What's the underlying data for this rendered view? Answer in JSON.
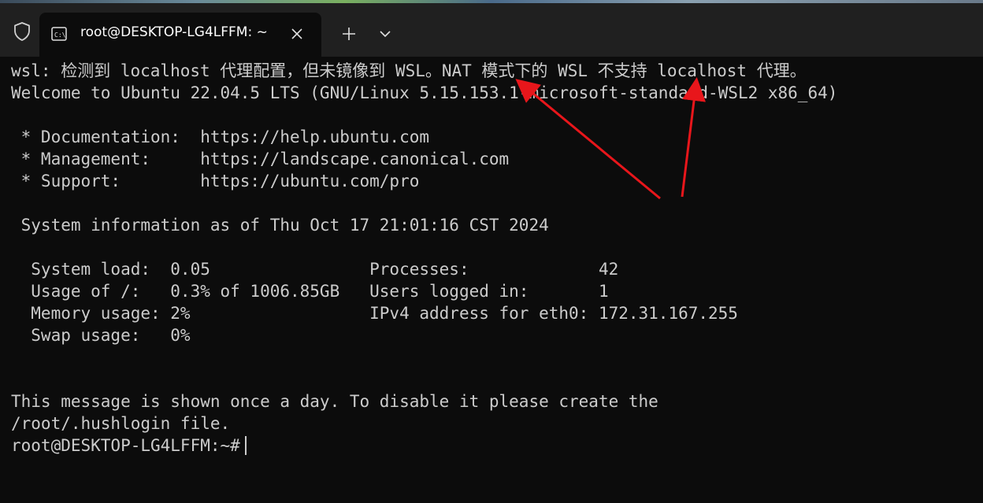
{
  "window": {
    "tab_title": "root@DESKTOP-LG4LFFM: ~",
    "tab_icon": "terminal-icon",
    "shield_icon": "shield-icon",
    "close_icon": "close-icon",
    "new_tab_icon": "plus-icon",
    "dropdown_icon": "chevron-down-icon"
  },
  "terminal": {
    "lines": [
      "wsl: 检测到 localhost 代理配置，但未镜像到 WSL。NAT 模式下的 WSL 不支持 localhost 代理。",
      "Welcome to Ubuntu 22.04.5 LTS (GNU/Linux 5.15.153.1-microsoft-standard-WSL2 x86_64)",
      "",
      " * Documentation:  https://help.ubuntu.com",
      " * Management:     https://landscape.canonical.com",
      " * Support:        https://ubuntu.com/pro",
      "",
      " System information as of Thu Oct 17 21:01:16 CST 2024",
      "",
      "  System load:  0.05                Processes:             42",
      "  Usage of /:   0.3% of 1006.85GB   Users logged in:       1",
      "  Memory usage: 2%                  IPv4 address for eth0: 172.31.167.255",
      "  Swap usage:   0%",
      "",
      "",
      "This message is shown once a day. To disable it please create the",
      "/root/.hushlogin file.",
      "root@DESKTOP-LG4LFFM:~#"
    ]
  },
  "colors": {
    "background": "#0c0c0c",
    "text": "#cccccc",
    "titlebar": "#202020",
    "annotation_arrow": "#e8161b"
  }
}
